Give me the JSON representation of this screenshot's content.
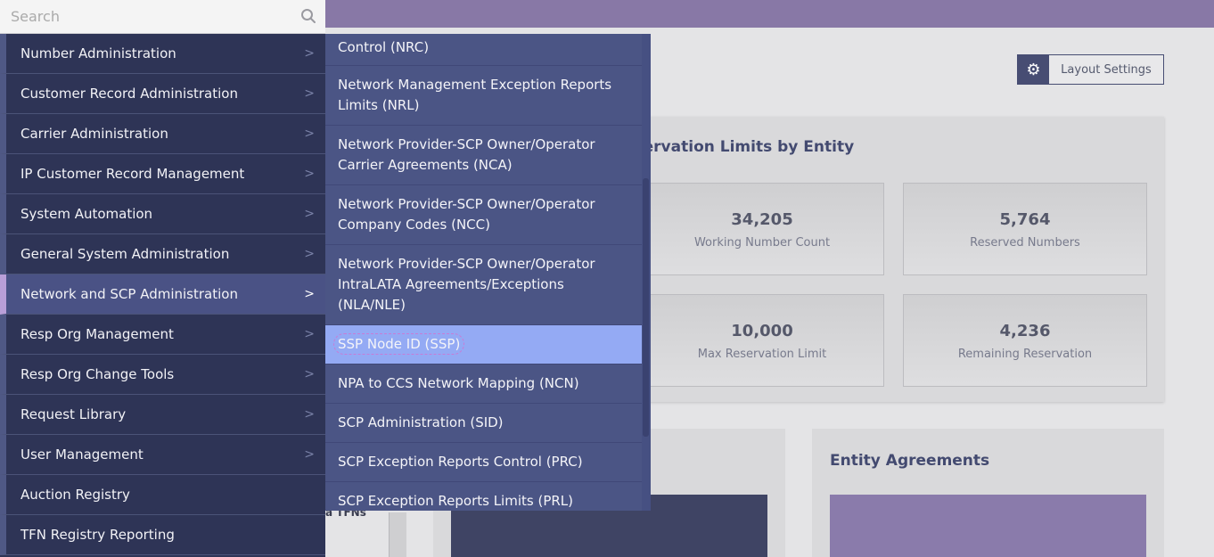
{
  "search": {
    "placeholder": "Search"
  },
  "main_menu": {
    "items": [
      {
        "label": "Number Administration",
        "has_submenu": true
      },
      {
        "label": "Customer Record Administration",
        "has_submenu": true
      },
      {
        "label": "Carrier Administration",
        "has_submenu": true
      },
      {
        "label": "IP Customer Record Management",
        "has_submenu": true
      },
      {
        "label": "System Automation",
        "has_submenu": true
      },
      {
        "label": "General System Administration",
        "has_submenu": true
      },
      {
        "label": "Network and SCP Administration",
        "has_submenu": true,
        "active": true
      },
      {
        "label": "Resp Org Management",
        "has_submenu": true
      },
      {
        "label": "Resp Org Change Tools",
        "has_submenu": true
      },
      {
        "label": "Request Library",
        "has_submenu": true
      },
      {
        "label": "User Management",
        "has_submenu": true
      },
      {
        "label": "Auction Registry",
        "has_submenu": false
      },
      {
        "label": "TFN Registry Reporting",
        "has_submenu": false
      }
    ]
  },
  "sub_menu": {
    "items": [
      {
        "label": "Control (NRC)"
      },
      {
        "label": "Network Management Exception Reports Limits (NRL)"
      },
      {
        "label": "Network Provider-SCP Owner/Operator Carrier Agreements (NCA)"
      },
      {
        "label": "Network Provider-SCP Owner/Operator Company Codes (NCC)"
      },
      {
        "label": "Network Provider-SCP Owner/Operator IntraLATA Agreements/Exceptions (NLA/NLE)"
      },
      {
        "label": "SSP Node ID (SSP)",
        "selected": true
      },
      {
        "label": "NPA to CCS Network Mapping (NCN)"
      },
      {
        "label": "SCP Administration (SID)"
      },
      {
        "label": "SCP Exception Reports Control (PRC)"
      },
      {
        "label": "SCP Exception Reports Limits (PRL)"
      }
    ]
  },
  "header": {
    "layout_settings_label": "Layout Settings"
  },
  "reservation_panel": {
    "title": "eservation Limits by Entity",
    "stats": [
      {
        "value": "34,205",
        "label": "Working Number Count"
      },
      {
        "value": "5,764",
        "label": "Reserved Numbers"
      },
      {
        "value": "10,000",
        "label": "Max Reservation Limit"
      },
      {
        "value": "4,236",
        "label": "Remaining Reservation"
      }
    ]
  },
  "entity_agreements": {
    "title": "Entity Agreements"
  },
  "fragment": {
    "tfns_label": "a TFNs"
  },
  "colors": {
    "menu_bg": "#2e3456",
    "submenu_bg": "#4b5585",
    "selected_bg": "#94aaf4",
    "active_accent": "#b99fd8",
    "topbar": "#8878a6"
  }
}
